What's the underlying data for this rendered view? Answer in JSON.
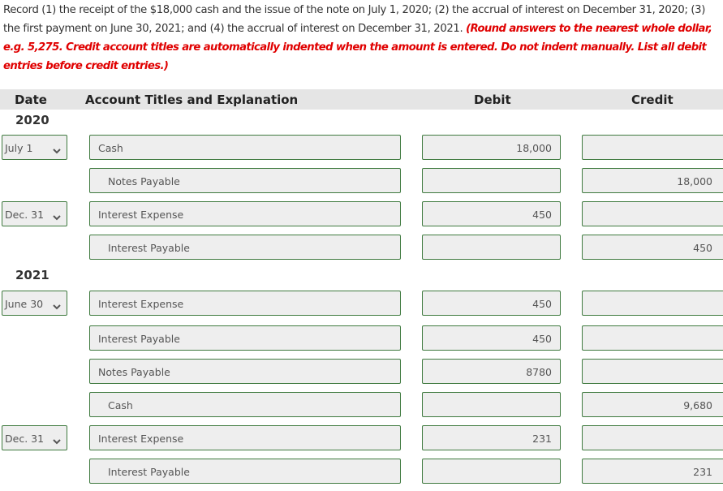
{
  "instructions": {
    "text": "Record (1) the receipt of the $18,000 cash and the issue of the note on July 1, 2020; (2) the accrual of interest on December 31, 2020; (3) the first payment on June 30, 2021; and (4) the accrual of interest on December 31, 2021. ",
    "note": "(Round answers to the nearest whole dollar, e.g. 5,275. Credit account titles are automatically indented when the amount is entered. Do not indent manually. List all debit entries before credit entries.)"
  },
  "header": {
    "date": "Date",
    "account": "Account Titles and Explanation",
    "debit": "Debit",
    "credit": "Credit"
  },
  "years": [
    "2020",
    "2021"
  ],
  "rows": [
    {
      "date": "July 1",
      "account": "Cash",
      "debit": "18,000",
      "credit": ""
    },
    {
      "date": "",
      "account": "Notes Payable",
      "debit": "",
      "credit": "18,000"
    },
    {
      "date": "Dec. 31",
      "account": "Interest Expense",
      "debit": "450",
      "credit": ""
    },
    {
      "date": "",
      "account": "Interest Payable",
      "debit": "",
      "credit": "450"
    },
    {
      "date": "June 30",
      "account": "Interest Expense",
      "debit": "450",
      "credit": ""
    },
    {
      "date": "",
      "account": "Interest Payable",
      "debit": "450",
      "credit": ""
    },
    {
      "date": "",
      "account": "Notes Payable",
      "debit": "8780",
      "credit": ""
    },
    {
      "date": "",
      "account": "Cash",
      "debit": "",
      "credit": "9,680"
    },
    {
      "date": "Dec. 31",
      "account": "Interest Expense",
      "debit": "231",
      "credit": ""
    },
    {
      "date": "",
      "account": "Interest Payable",
      "debit": "",
      "credit": "231"
    }
  ],
  "colors": {
    "border": "#3f7a3f",
    "field_bg": "#eeeeee",
    "note_red": "#e00000",
    "header_bg": "#e5e5e5"
  }
}
